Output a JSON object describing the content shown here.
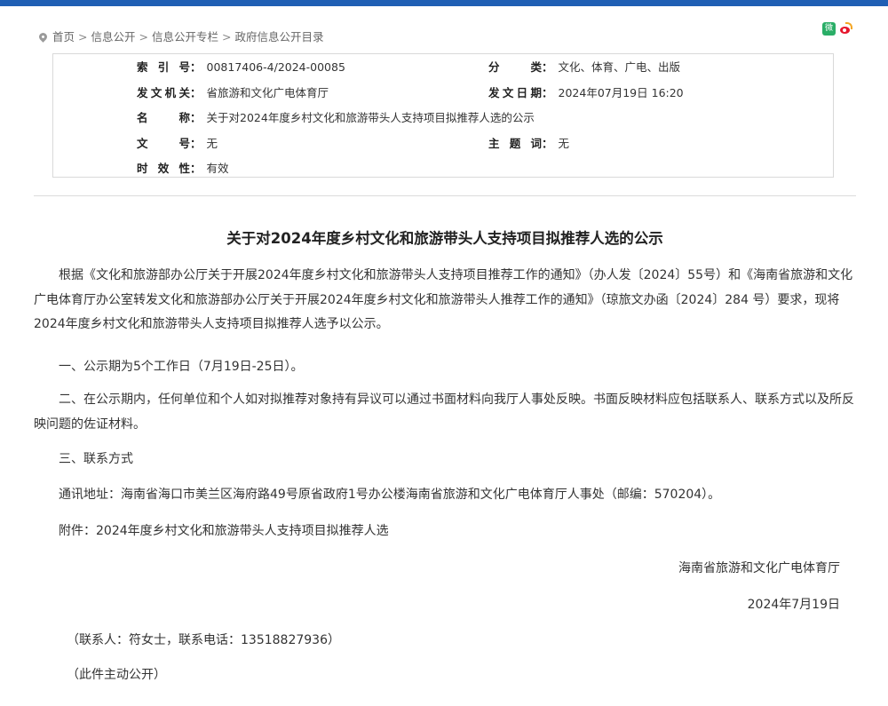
{
  "breadcrumb": {
    "items": [
      "首页",
      "信息公开",
      "信息公开专栏",
      "政府信息公开目录"
    ],
    "separator": ">"
  },
  "share": {
    "wechat_icon": "wechat-icon",
    "weibo_icon": "weibo-icon",
    "wechat_glyph": "微"
  },
  "meta": {
    "index_label": "索 引 号",
    "index_value": "00817406-4/2024-00085",
    "category_label": "分 类",
    "category_value": "文化、体育、广电、出版",
    "issuer_label": "发文机关",
    "issuer_value": "省旅游和文化广电体育厅",
    "date_label": "发文日期",
    "date_value": "2024年07月19日 16:20",
    "name_label": "名 称",
    "name_value": "关于对2024年度乡村文化和旅游带头人支持项目拟推荐人选的公示",
    "docno_label": "文 号",
    "docno_value": "无",
    "keyword_label": "主 题 词",
    "keyword_value": "无",
    "validity_label": "时 效 性",
    "validity_value": "有效"
  },
  "article": {
    "title": "关于对2024年度乡村文化和旅游带头人支持项目拟推荐人选的公示",
    "para1": "根据《文化和旅游部办公厅关于开展2024年度乡村文化和旅游带头人支持项目推荐工作的通知》（办人发〔2024〕55号）和《海南省旅游和文化广电体育厅办公室转发文化和旅游部办公厅关于开展2024年度乡村文化和旅游带头人推荐工作的通知》（琼旅文办函〔2024〕284 号）要求，现将2024年度乡村文化和旅游带头人支持项目拟推荐人选予以公示。",
    "item1": "一、公示期为5个工作日（7月19日-25日）。",
    "item2": "二、在公示期内，任何单位和个人如对拟推荐对象持有异议可以通过书面材料向我厅人事处反映。书面反映材料应包括联系人、联系方式以及所反映问题的佐证材料。",
    "item3": "三、联系方式",
    "address": "通讯地址：海南省海口市美兰区海府路49号原省政府1号办公楼海南省旅游和文化广电体育厅人事处（邮编：570204）。",
    "attachment": "附件：2024年度乡村文化和旅游带头人支持项目拟推荐人选",
    "signature": "海南省旅游和文化广电体育厅",
    "sign_date": "2024年7月19日",
    "contact": "（联系人：符女士，联系电话：13518827936）",
    "disclosure": "（此件主动公开）"
  }
}
